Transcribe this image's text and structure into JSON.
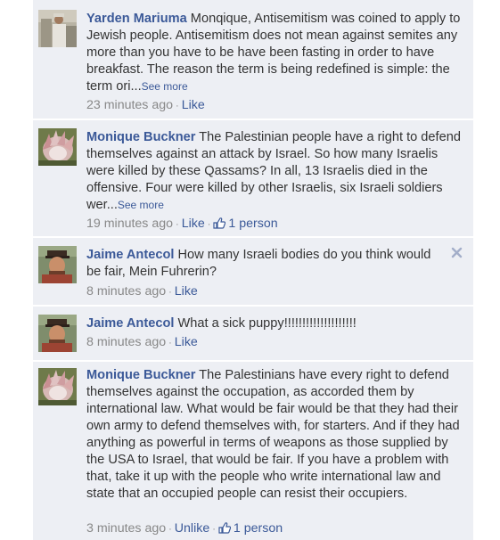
{
  "comments": [
    {
      "author": "Yarden Mariuma",
      "text": " Monqique, Antisemitism was coined to apply to Jewish people. Antisemitism does not mean against semites any more than you have to be have been fasting in order to have breakfast. The reason the term is being redefined is simple: the term ori...",
      "see_more": "See more",
      "time": "23 minutes ago",
      "like": "Like"
    },
    {
      "author": "Monique Buckner",
      "text": " The Palestinian people have a right to defend themselves against an attack by Israel. So how many Israelis were killed by these Qassams? In all, 13 Israelis died in the offensive. Four were killed by other Israelis, six Israeli soldiers wer...",
      "see_more": "See more",
      "time": "19 minutes ago",
      "like": "Like",
      "likes_count": "1 person"
    },
    {
      "author": "Jaime Antecol",
      "text": " How many Israeli bodies do you think would be fair, Mein Fuhrerin?",
      "time": "8 minutes ago",
      "like": "Like"
    },
    {
      "author": "Jaime Antecol",
      "text": " What a sick puppy!!!!!!!!!!!!!!!!!!!!",
      "time": "8 minutes ago",
      "like": "Like"
    },
    {
      "author": "Monique Buckner",
      "text": " The Palestinians have every right to defend themselves against the occupation, as accorded them by international law. What would be fair would be that they had their own army to defend themselves with, for starters. And if they had anything as powerful in terms of weapons as those supplied by the USA to Israel, that would be fair. If you have a problem with that, take it up with the people who write international law and state that an occupied people can resist their occupiers.",
      "time": "3 minutes ago",
      "like": "Unlike",
      "likes_count": "1 person"
    }
  ],
  "icons": {
    "close": "close-icon",
    "thumb": "thumbs-up-icon"
  },
  "colors": {
    "background": "#edeff4",
    "link": "#3b5998",
    "text": "#333333",
    "meta": "#888888"
  }
}
